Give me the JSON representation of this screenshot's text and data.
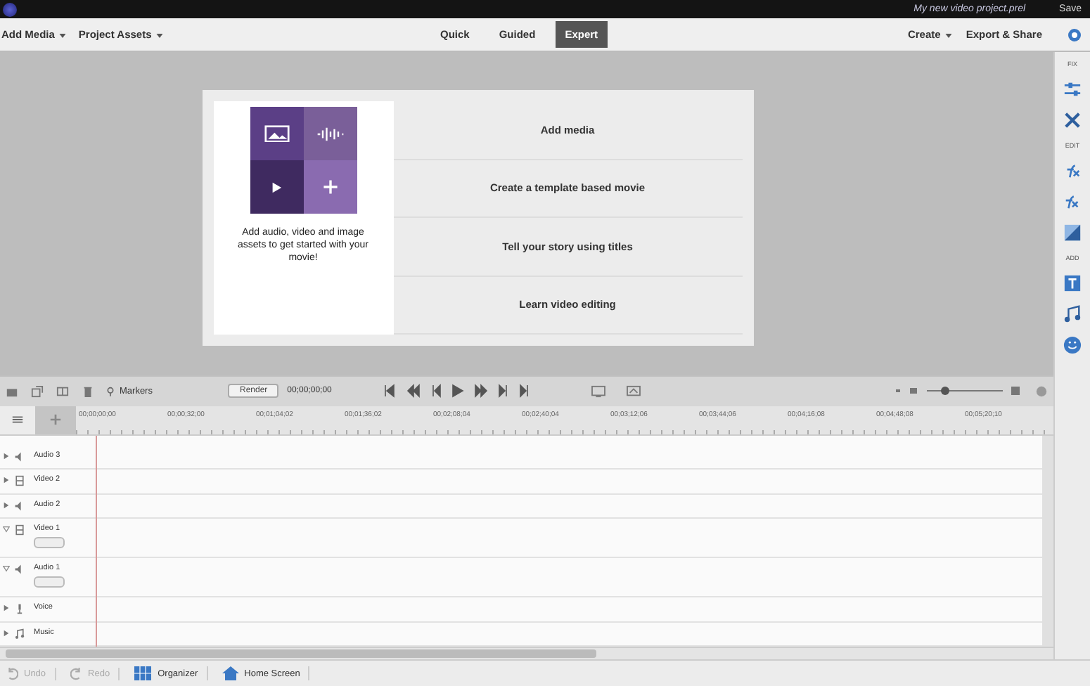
{
  "title_bar": {
    "project_name": "My new video project.prel",
    "save": "Save"
  },
  "menu_bar": {
    "left": [
      "Add Media",
      "Project Assets"
    ],
    "right": [
      "Create",
      "Export & Share"
    ]
  },
  "mode_tabs": [
    {
      "label": "Quick",
      "selected": false
    },
    {
      "label": "Guided",
      "selected": false
    },
    {
      "label": "Expert",
      "selected": true
    }
  ],
  "start_card": {
    "caption": "Add audio, video and image assets to get started with your movie!",
    "actions": [
      "Add media",
      "Create a template based movie",
      "Tell your story using titles",
      "Learn video editing"
    ]
  },
  "timeline_toolbar": {
    "markers": "Markers",
    "render": "Render",
    "timecode": "00;00;00;00"
  },
  "ruler": [
    "00;00;00;00",
    "00;00;32;00",
    "00;01;04;02",
    "00;01;36;02",
    "00;02;08;04",
    "00;02;40;04",
    "00;03;12;06",
    "00;03;44;06",
    "00;04;16;08",
    "00;04;48;08",
    "00;05;20;10"
  ],
  "tracks": [
    {
      "name": "Audio 3",
      "kind": "audio",
      "expanded": false
    },
    {
      "name": "Video 2",
      "kind": "video",
      "expanded": false
    },
    {
      "name": "Audio 2",
      "kind": "audio",
      "expanded": false
    },
    {
      "name": "Video 1",
      "kind": "video",
      "expanded": true
    },
    {
      "name": "Audio 1",
      "kind": "audio",
      "expanded": true
    },
    {
      "name": "Voice",
      "kind": "voice",
      "expanded": false
    },
    {
      "name": "Music",
      "kind": "music",
      "expanded": false
    }
  ],
  "right_panel": {
    "sections": [
      "FIX",
      "EDIT",
      "ADD"
    ]
  },
  "bottom_bar": {
    "undo": "Undo",
    "redo": "Redo",
    "organizer": "Organizer",
    "home_screen": "Home Screen"
  }
}
